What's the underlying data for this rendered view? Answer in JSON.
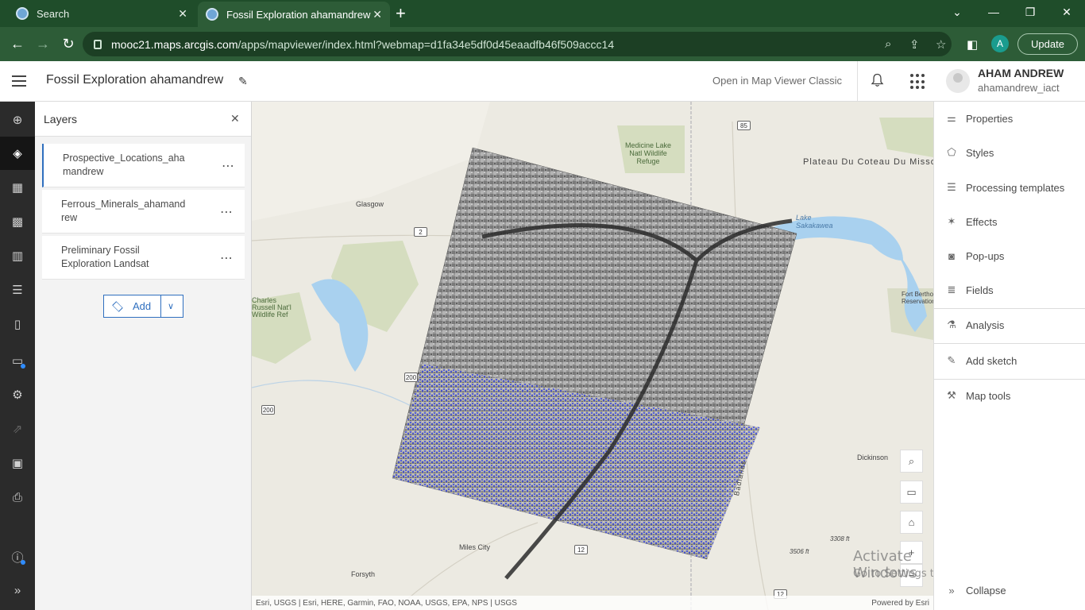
{
  "browser": {
    "tabs": [
      {
        "label": "Search",
        "icon": "google-icon"
      },
      {
        "label": "Fossil Exploration ahamandrew",
        "icon": "arcgis-icon"
      }
    ],
    "url_host": "mooc21.maps.arcgis.com",
    "url_path": "/apps/mapviewer/index.html?webmap=d1fa34e5df0d45eaadfb46f509accc14",
    "profile_initial": "A",
    "update_label": "Update"
  },
  "header": {
    "title": "Fossil Exploration ahamandrew",
    "open_classic": "Open in Map Viewer Classic",
    "user_name": "AHAM ANDREW",
    "user_id": "ahamandrew_iact"
  },
  "layers_panel": {
    "title": "Layers",
    "layers": [
      {
        "name": "Prospective_Locations_ahamandrew"
      },
      {
        "name": "Ferrous_Minerals_ahamandrew"
      },
      {
        "name": "Preliminary Fossil Exploration Landsat"
      }
    ],
    "add_label": "Add"
  },
  "map": {
    "labels": {
      "glasgow": "Glasgow",
      "medicine_lake": "Medicine Lake\nNatl Wildlife\nRefuge",
      "plateau": "Plateau Du Coteau Du Missouri",
      "lake_sakakawea": "Lake\nSakakawea",
      "charles_russell": "Charles\nRussell Nat'l\nWildlife Ref",
      "fort_berthold": "Fort Berthold\nReservation",
      "dickinson": "Dickinson",
      "badlands": "Badlands",
      "miles_city": "Miles City",
      "forsyth": "Forsyth",
      "elev1": "3506 ft",
      "elev2": "3308 ft"
    },
    "shields": {
      "s85": "85",
      "s2": "2",
      "s200a": "200",
      "s200b": "200",
      "s12": "12",
      "s12b": "12"
    },
    "attribution_left": "Esri, USGS | Esri, HERE, Garmin, FAO, NOAA, USGS, EPA, NPS | USGS",
    "attribution_right": "Powered by Esri",
    "watermark_title": "Activate Windows",
    "watermark_sub": "Go to Settings to activate Windows."
  },
  "right_panel": {
    "items": [
      {
        "label": "Properties",
        "icon": "properties-icon"
      },
      {
        "label": "Styles",
        "icon": "styles-icon"
      },
      {
        "label": "Processing templates",
        "icon": "processing-icon"
      },
      {
        "label": "Effects",
        "icon": "effects-icon"
      },
      {
        "label": "Pop-ups",
        "icon": "popups-icon"
      },
      {
        "label": "Fields",
        "icon": "fields-icon"
      },
      {
        "label": "Analysis",
        "icon": "analysis-icon"
      },
      {
        "label": "Add sketch",
        "icon": "sketch-icon"
      },
      {
        "label": "Map tools",
        "icon": "map-tools-icon"
      }
    ],
    "collapse_label": "Collapse"
  }
}
